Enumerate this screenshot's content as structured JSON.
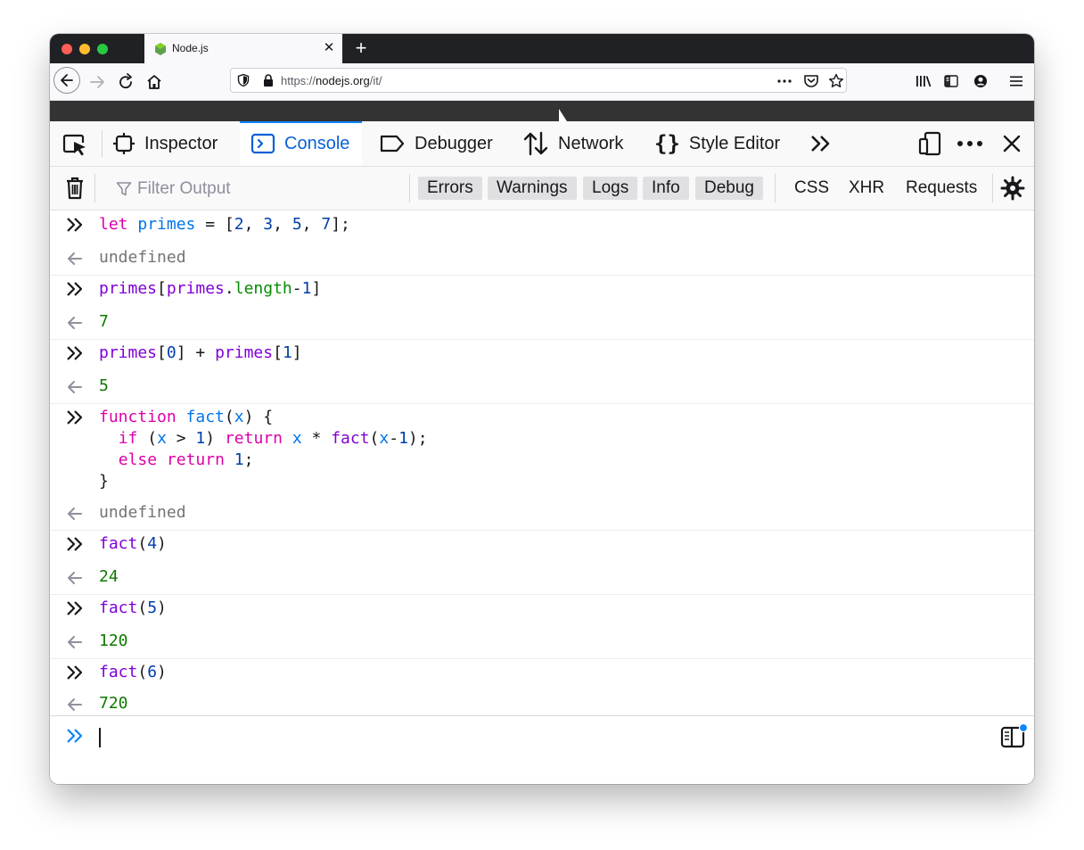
{
  "browser": {
    "tab_title": "Node.js",
    "url_scheme": "https://",
    "url_host": "nodejs.org",
    "url_path": "/it/"
  },
  "devtools": {
    "tabs": [
      {
        "label": "Inspector"
      },
      {
        "label": "Console"
      },
      {
        "label": "Debugger"
      },
      {
        "label": "Network"
      },
      {
        "label": "Style Editor"
      }
    ],
    "active_tab": "Console",
    "filter_placeholder": "Filter Output",
    "filter_chips": [
      "Errors",
      "Warnings",
      "Logs",
      "Info",
      "Debug"
    ],
    "request_filters": [
      "CSS",
      "XHR",
      "Requests"
    ]
  },
  "console": {
    "entries": [
      {
        "input": "let primes = [2, 3, 5, 7];",
        "result": "undefined"
      },
      {
        "input": "primes[primes.length-1]",
        "result": "7"
      },
      {
        "input": "primes[0] + primes[1]",
        "result": "5"
      },
      {
        "input": "function fact(x) {\n  if (x > 1) return x * fact(x-1);\n  else return 1;\n}",
        "result": "undefined"
      },
      {
        "input": "fact(4)",
        "result": "24"
      },
      {
        "input": "fact(5)",
        "result": "120"
      },
      {
        "input": "fact(6)",
        "result": "720"
      }
    ]
  },
  "colors": {
    "accent": "#0a84ff",
    "keyword": "#dd00a9",
    "variable": "#0074e8",
    "function": "#8000d7",
    "number": "#003eaa",
    "result_number": "#0f7800",
    "undefined": "#737373"
  },
  "icons": [
    "node-favicon",
    "back-arrow-icon",
    "forward-arrow-icon",
    "reload-icon",
    "home-icon",
    "shield-icon",
    "lock-icon",
    "page-actions-icon",
    "pocket-icon",
    "bookmark-star-icon",
    "library-icon",
    "sidebar-icon",
    "account-icon",
    "hamburger-menu-icon",
    "element-picker-icon",
    "inspector-icon",
    "console-icon",
    "debugger-icon",
    "network-icon",
    "style-editor-icon",
    "more-tools-icon",
    "responsive-mode-icon",
    "meatball-menu-icon",
    "close-toolbox-icon",
    "trash-icon",
    "filter-icon",
    "settings-gear-icon",
    "prompt-icon",
    "result-arrow-icon",
    "editor-toggle-icon"
  ]
}
